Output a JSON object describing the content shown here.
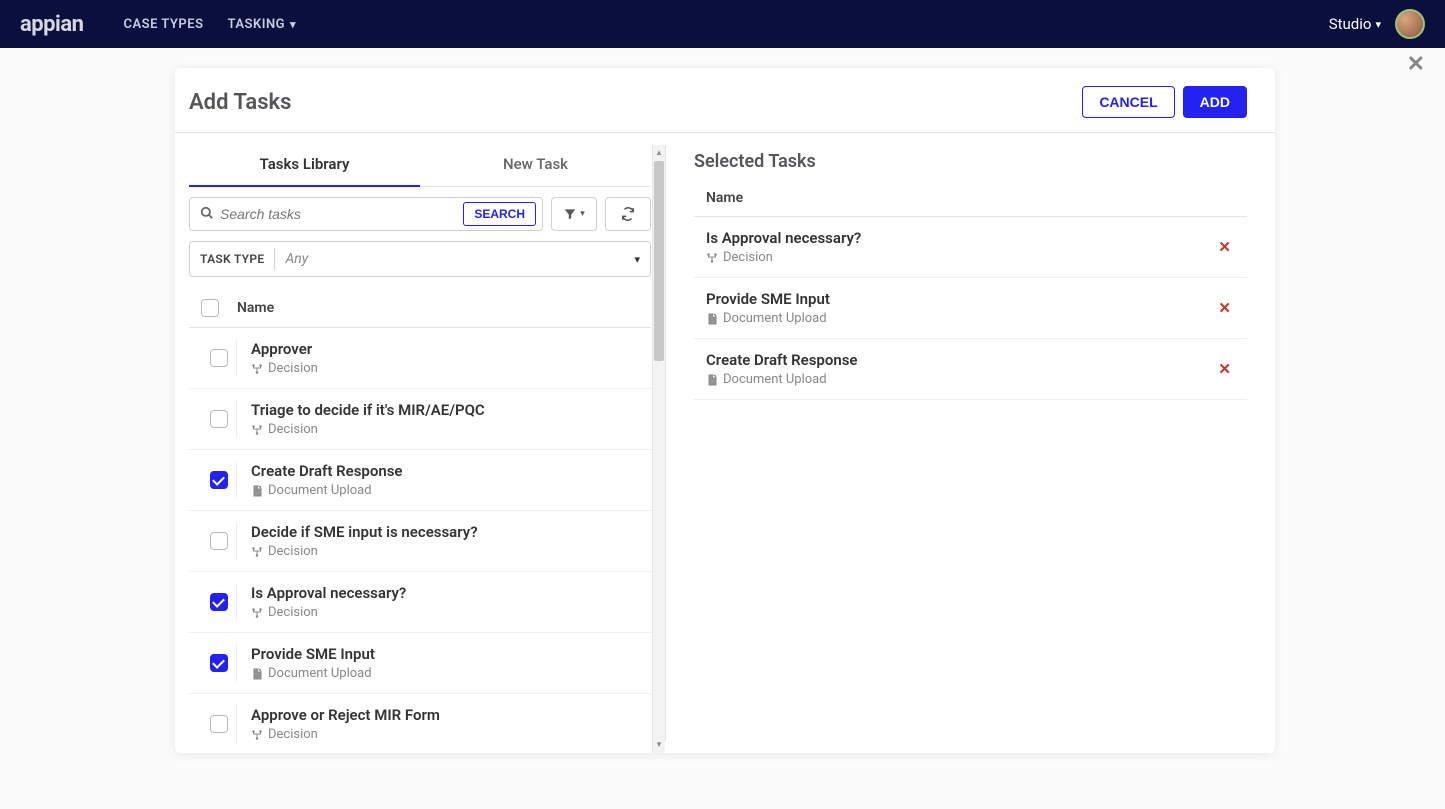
{
  "nav": {
    "logo": "appian",
    "items": [
      "CASE TYPES",
      "TASKING"
    ],
    "right_label": "Studio"
  },
  "modal": {
    "title": "Add Tasks",
    "cancel_label": "CANCEL",
    "add_label": "ADD"
  },
  "tabs": {
    "library": "Tasks Library",
    "new_task": "New Task"
  },
  "search": {
    "placeholder": "Search tasks",
    "button": "SEARCH"
  },
  "task_type_filter": {
    "label": "TASK TYPE",
    "value": "Any"
  },
  "library": {
    "column_name": "Name",
    "tasks": [
      {
        "name": "Approver",
        "type": "Decision",
        "type_icon": "decision",
        "checked": false
      },
      {
        "name": "Triage to decide if it's MIR/AE/PQC",
        "type": "Decision",
        "type_icon": "decision",
        "checked": false
      },
      {
        "name": "Create Draft Response",
        "type": "Document Upload",
        "type_icon": "document",
        "checked": true
      },
      {
        "name": "Decide if SME input is necessary?",
        "type": "Decision",
        "type_icon": "decision",
        "checked": false
      },
      {
        "name": "Is Approval necessary?",
        "type": "Decision",
        "type_icon": "decision",
        "checked": true
      },
      {
        "name": "Provide SME Input",
        "type": "Document Upload",
        "type_icon": "document",
        "checked": true
      },
      {
        "name": "Approve or Reject MIR Form",
        "type": "Decision",
        "type_icon": "decision",
        "checked": false
      }
    ]
  },
  "selected": {
    "title": "Selected Tasks",
    "column_name": "Name",
    "tasks": [
      {
        "name": "Is Approval necessary?",
        "type": "Decision",
        "type_icon": "decision"
      },
      {
        "name": "Provide SME Input",
        "type": "Document Upload",
        "type_icon": "document"
      },
      {
        "name": "Create Draft Response",
        "type": "Document Upload",
        "type_icon": "document"
      }
    ]
  }
}
